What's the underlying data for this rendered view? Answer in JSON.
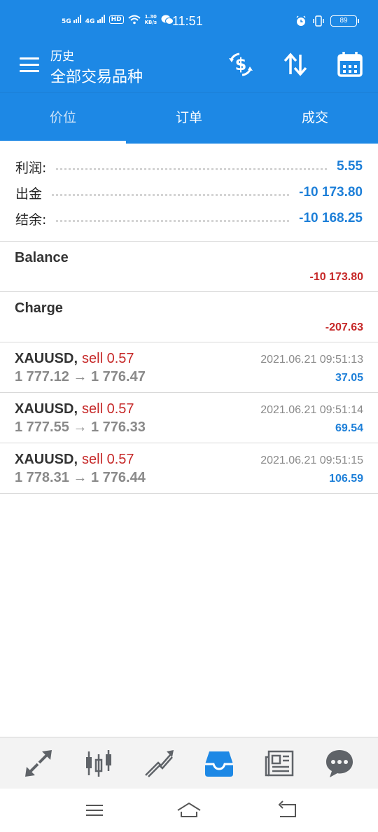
{
  "status": {
    "network_left": "5G",
    "network_right": "4G",
    "hd": "HD",
    "speed_value": "1.30",
    "speed_unit": "KB/s",
    "time": "11:51",
    "battery": "89"
  },
  "appbar": {
    "subtitle": "历史",
    "title": "全部交易品种"
  },
  "tabs": [
    {
      "label": "价位",
      "active": true
    },
    {
      "label": "订单",
      "active": false
    },
    {
      "label": "成交",
      "active": false
    }
  ],
  "summary": [
    {
      "label": "利润:",
      "value": "5.55"
    },
    {
      "label": "出金",
      "value": "-10 173.80"
    },
    {
      "label": "结余:",
      "value": "-10 168.25"
    }
  ],
  "operations": [
    {
      "title": "Balance",
      "value": "-10 173.80"
    },
    {
      "title": "Charge",
      "value": "-207.63"
    }
  ],
  "deals": [
    {
      "symbol": "XAUUSD,",
      "type": "sell 0.57",
      "prices": "1 777.12 → 1 776.47",
      "time": "2021.06.21 09:51:13",
      "profit": "37.05"
    },
    {
      "symbol": "XAUUSD,",
      "type": "sell 0.57",
      "prices": "1 777.55 → 1 776.33",
      "time": "2021.06.21 09:51:14",
      "profit": "69.54"
    },
    {
      "symbol": "XAUUSD,",
      "type": "sell 0.57",
      "prices": "1 778.31 → 1 776.44",
      "time": "2021.06.21 09:51:15",
      "profit": "106.59"
    }
  ],
  "bottom_nav": [
    {
      "icon": "quotes-icon",
      "active": false
    },
    {
      "icon": "chart-icon",
      "active": false
    },
    {
      "icon": "trade-icon",
      "active": false
    },
    {
      "icon": "history-icon",
      "active": true
    },
    {
      "icon": "news-icon",
      "active": false
    },
    {
      "icon": "chat-icon",
      "active": false
    }
  ],
  "colors": {
    "primary": "#1d88e5",
    "negative": "#c62828",
    "positive": "#1d7fd8",
    "muted": "#8a8a8a",
    "nav_icon": "#5f6368"
  }
}
